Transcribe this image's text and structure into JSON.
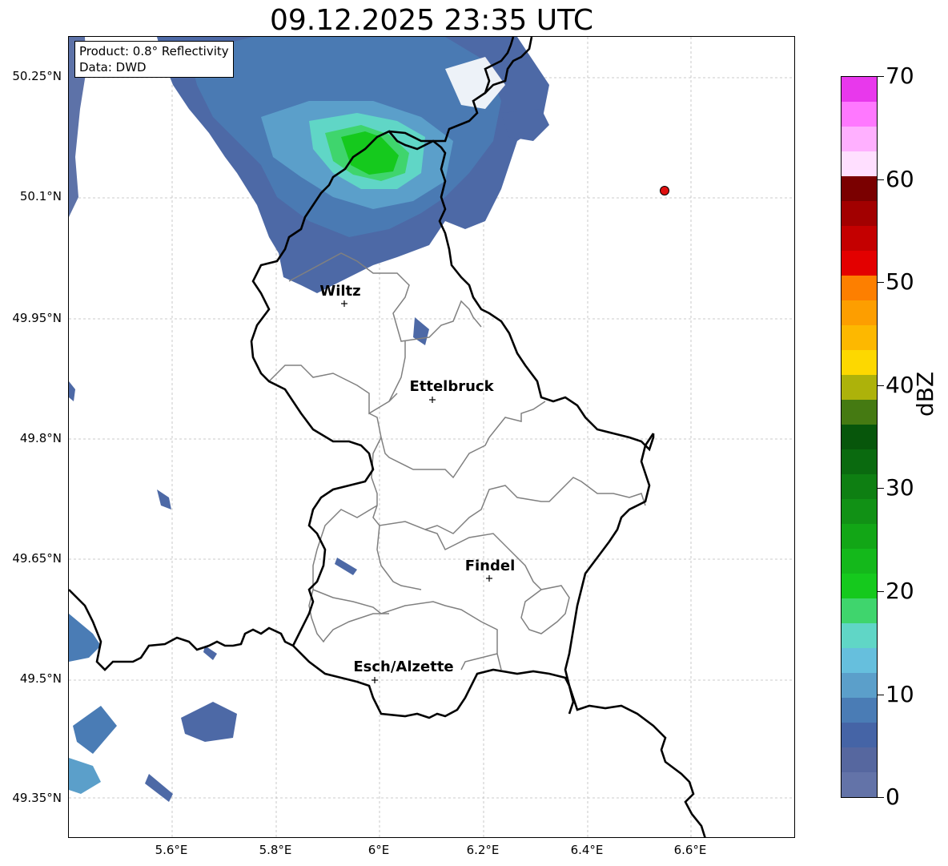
{
  "title": "09.12.2025 23:35 UTC",
  "info_box": {
    "product": "Product: 0.8° Reflectivity",
    "data": "Data: DWD"
  },
  "lat_labels": [
    "50.25°N",
    "50.1°N",
    "49.95°N",
    "49.8°N",
    "49.65°N",
    "49.5°N",
    "49.35°N"
  ],
  "lon_labels": [
    "5.6°E",
    "5.8°E",
    "6°E",
    "6.2°E",
    "6.4°E",
    "6.6°E"
  ],
  "cities": [
    {
      "name": "Wiltz",
      "lon": 5.93,
      "lat": 49.966
    },
    {
      "name": "Ettelbruck",
      "lon": 6.1,
      "lat": 49.846
    },
    {
      "name": "Findel",
      "lon": 6.21,
      "lat": 49.626
    },
    {
      "name": "Esch/Alzette",
      "lon": 5.99,
      "lat": 49.498
    }
  ],
  "radar_site_marker": {
    "lon": 6.547,
    "lat": 50.11,
    "color": "#e01010"
  },
  "colorbar": {
    "label": "dBZ",
    "ticks": [
      "0",
      "10",
      "20",
      "30",
      "40",
      "50",
      "60",
      "70"
    ],
    "colors": [
      "#6373a8",
      "#56679f",
      "#4564a6",
      "#4a7cb5",
      "#5b9fca",
      "#66bfdd",
      "#60d6c6",
      "#3fd56d",
      "#15c91d",
      "#14b81b",
      "#12a616",
      "#119115",
      "#0e7f12",
      "#0a6a0f",
      "#07560b",
      "#457a12",
      "#adb20a",
      "#fdd800",
      "#fdb800",
      "#fd9e00",
      "#fd7f00",
      "#e30000",
      "#c40000",
      "#a20000",
      "#7a0000",
      "#ffdfff",
      "#ffb0ff",
      "#ff78ff",
      "#e838ec"
    ]
  }
}
